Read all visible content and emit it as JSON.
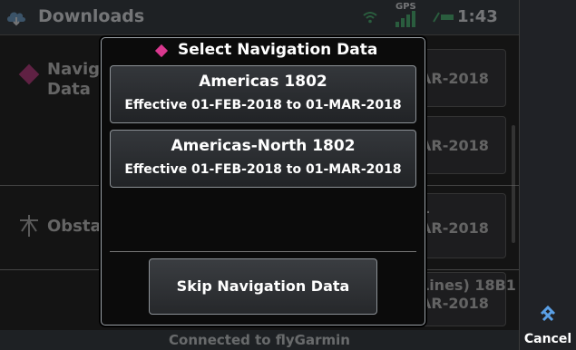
{
  "status_bar": {
    "title": "Downloads",
    "time": "1:43",
    "gps_label": "GPS"
  },
  "background_rows": [
    {
      "label_line1": "Naviga",
      "label_line2": "Data",
      "button_a": "AR-2018",
      "button_b": "AR-2018"
    },
    {
      "label": "Obsta",
      "button_line1": "1",
      "button_line2": "AR-2018"
    },
    {
      "button_line1": "Lines) 18B1",
      "button_line2": "AR-2018"
    }
  ],
  "footer": {
    "text": "Connected to flyGarmin"
  },
  "modal": {
    "title": "Select Navigation Data",
    "options": [
      {
        "name": "Americas 1802",
        "effective": "Effective 01-FEB-2018 to 01-MAR-2018"
      },
      {
        "name": "Americas-North 1802",
        "effective": "Effective 01-FEB-2018 to 01-MAR-2018"
      }
    ],
    "skip_label": "Skip Navigation Data"
  },
  "right_bar": {
    "cancel_label": "Cancel"
  },
  "colors": {
    "accent_diamond": "#d9388f",
    "cancel_icon": "#5aa0e6"
  }
}
